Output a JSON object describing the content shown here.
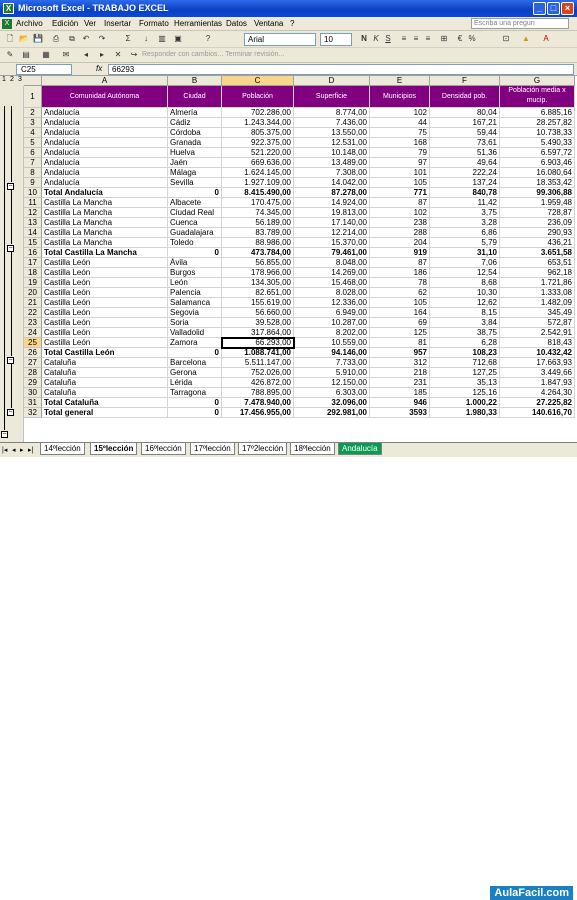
{
  "window": {
    "title": "Microsoft Excel - TRABAJO EXCEL"
  },
  "menu": {
    "items": [
      "Archivo",
      "Edición",
      "Ver",
      "Insertar",
      "Formato",
      "Herramientas",
      "Datos",
      "Ventana",
      "?"
    ],
    "help_placeholder": "Escriba una pregun"
  },
  "format_bar": {
    "font": "Arial",
    "size": "10"
  },
  "review_bar": {
    "label": "Responder con cambios...  Terminar revisión..."
  },
  "formula_bar": {
    "name_box": "C25",
    "fx": "fx",
    "value": "66293"
  },
  "outline_levels": [
    "1",
    "2",
    "3"
  ],
  "columns": [
    "A",
    "B",
    "C",
    "D",
    "E",
    "F",
    "G"
  ],
  "selected_column": "C",
  "header_row": {
    "row": "1",
    "cells": [
      "Comunidad Autónoma",
      "Ciudad",
      "Población",
      "Superficie",
      "Municipios",
      "Densidad pob.",
      "Población media x mucip."
    ]
  },
  "rows": [
    {
      "n": "2",
      "cells": [
        "Andalucía",
        "Almería",
        "702.286,00",
        "8.774,00",
        "102",
        "80,04",
        "6.885,16"
      ]
    },
    {
      "n": "3",
      "cells": [
        "Andalucía",
        "Cádiz",
        "1.243.344,00",
        "7.436,00",
        "44",
        "167,21",
        "28.257,82"
      ]
    },
    {
      "n": "4",
      "cells": [
        "Andalucía",
        "Córdoba",
        "805.375,00",
        "13.550,00",
        "75",
        "59,44",
        "10.738,33"
      ]
    },
    {
      "n": "5",
      "cells": [
        "Andalucía",
        "Granada",
        "922.375,00",
        "12.531,00",
        "168",
        "73,61",
        "5.490,33"
      ]
    },
    {
      "n": "6",
      "cells": [
        "Andalucía",
        "Huelva",
        "521.220,00",
        "10.148,00",
        "79",
        "51,36",
        "6.597,72"
      ]
    },
    {
      "n": "7",
      "cells": [
        "Andalucía",
        "Jaén",
        "669.636,00",
        "13.489,00",
        "97",
        "49,64",
        "6.903,46"
      ]
    },
    {
      "n": "8",
      "cells": [
        "Andalucía",
        "Málaga",
        "1.624.145,00",
        "7.308,00",
        "101",
        "222,24",
        "16.080,64"
      ]
    },
    {
      "n": "9",
      "cells": [
        "Andalucía",
        "Sevilla",
        "1.927.109,00",
        "14.042,00",
        "105",
        "137,24",
        "18.353,42"
      ]
    },
    {
      "n": "10",
      "bold": true,
      "cells": [
        "Total Andalucía",
        "0",
        "8.415.490,00",
        "87.278,00",
        "771",
        "840,78",
        "99.306,88"
      ]
    },
    {
      "n": "11",
      "cells": [
        "Castilla La Mancha",
        "Albacete",
        "170.475,00",
        "14.924,00",
        "87",
        "11,42",
        "1.959,48"
      ]
    },
    {
      "n": "12",
      "cells": [
        "Castilla La Mancha",
        "Ciudad Real",
        "74.345,00",
        "19.813,00",
        "102",
        "3,75",
        "728,87"
      ]
    },
    {
      "n": "13",
      "cells": [
        "Castilla La Mancha",
        "Cuenca",
        "56.189,00",
        "17.140,00",
        "238",
        "3,28",
        "236,09"
      ]
    },
    {
      "n": "14",
      "cells": [
        "Castilla La Mancha",
        "Guadalajara",
        "83.789,00",
        "12.214,00",
        "288",
        "6,86",
        "290,93"
      ]
    },
    {
      "n": "15",
      "cells": [
        "Castilla La Mancha",
        "Toledo",
        "88.986,00",
        "15.370,00",
        "204",
        "5,79",
        "436,21"
      ]
    },
    {
      "n": "16",
      "bold": true,
      "cells": [
        "Total Castilla La Mancha",
        "0",
        "473.784,00",
        "79.461,00",
        "919",
        "31,10",
        "3.651,58"
      ]
    },
    {
      "n": "17",
      "cells": [
        "Castilla León",
        "Ávila",
        "56.855,00",
        "8.048,00",
        "87",
        "7,06",
        "653,51"
      ]
    },
    {
      "n": "18",
      "cells": [
        "Castilla León",
        "Burgos",
        "178.966,00",
        "14.269,00",
        "186",
        "12,54",
        "962,18"
      ]
    },
    {
      "n": "19",
      "cells": [
        "Castilla León",
        "León",
        "134.305,00",
        "15.468,00",
        "78",
        "8,68",
        "1.721,86"
      ]
    },
    {
      "n": "20",
      "cells": [
        "Castilla León",
        "Palencia",
        "82.651,00",
        "8.028,00",
        "62",
        "10,30",
        "1.333,08"
      ]
    },
    {
      "n": "21",
      "cells": [
        "Castilla León",
        "Salamanca",
        "155.619,00",
        "12.336,00",
        "105",
        "12,62",
        "1.482,09"
      ]
    },
    {
      "n": "22",
      "cells": [
        "Castilla León",
        "Segovia",
        "56.660,00",
        "6.949,00",
        "164",
        "8,15",
        "345,49"
      ]
    },
    {
      "n": "23",
      "cells": [
        "Castilla León",
        "Soria",
        "39.528,00",
        "10.287,00",
        "69",
        "3,84",
        "572,87"
      ]
    },
    {
      "n": "24",
      "cells": [
        "Castilla León",
        "Valladolid",
        "317.864,00",
        "8.202,00",
        "125",
        "38,75",
        "2.542,91"
      ]
    },
    {
      "n": "25",
      "cells": [
        "Castilla León",
        "Zamora",
        "66.293,00",
        "10.559,00",
        "81",
        "6,28",
        "818,43"
      ]
    },
    {
      "n": "26",
      "bold": true,
      "cells": [
        "Total Castilla León",
        "0",
        "1.088.741,00",
        "94.146,00",
        "957",
        "108,23",
        "10.432,42"
      ]
    },
    {
      "n": "27",
      "cells": [
        "Cataluña",
        "Barcelona",
        "5.511.147,00",
        "7.733,00",
        "312",
        "712,68",
        "17.663,93"
      ]
    },
    {
      "n": "28",
      "cells": [
        "Cataluña",
        "Gerona",
        "752.026,00",
        "5.910,00",
        "218",
        "127,25",
        "3.449,66"
      ]
    },
    {
      "n": "29",
      "cells": [
        "Cataluña",
        "Lérida",
        "426.872,00",
        "12.150,00",
        "231",
        "35,13",
        "1.847,93"
      ]
    },
    {
      "n": "30",
      "cells": [
        "Cataluña",
        "Tarragona",
        "788.895,00",
        "6.303,00",
        "185",
        "125,16",
        "4.264,30"
      ]
    },
    {
      "n": "31",
      "bold": true,
      "cells": [
        "Total Cataluña",
        "0",
        "7.478.940,00",
        "32.096,00",
        "946",
        "1.000,22",
        "27.225,82"
      ]
    },
    {
      "n": "32",
      "bold": true,
      "cells": [
        "Total general",
        "0",
        "17.456.955,00",
        "292.981,00",
        "3593",
        "1.980,33",
        "140.616,70"
      ]
    }
  ],
  "active_row": "25",
  "sheet_tabs": [
    "14ºlección",
    "15ºlección",
    "16ºlección",
    "17ºlección",
    "17º2lección",
    "18ºlección",
    "Andalucía"
  ],
  "active_tab": "Andalucía",
  "watermark": "AulaFacil.com",
  "colors": {
    "header_fill": "#800080",
    "active_tab": "#0a9b52",
    "title_bar": "#0a3fc0"
  }
}
